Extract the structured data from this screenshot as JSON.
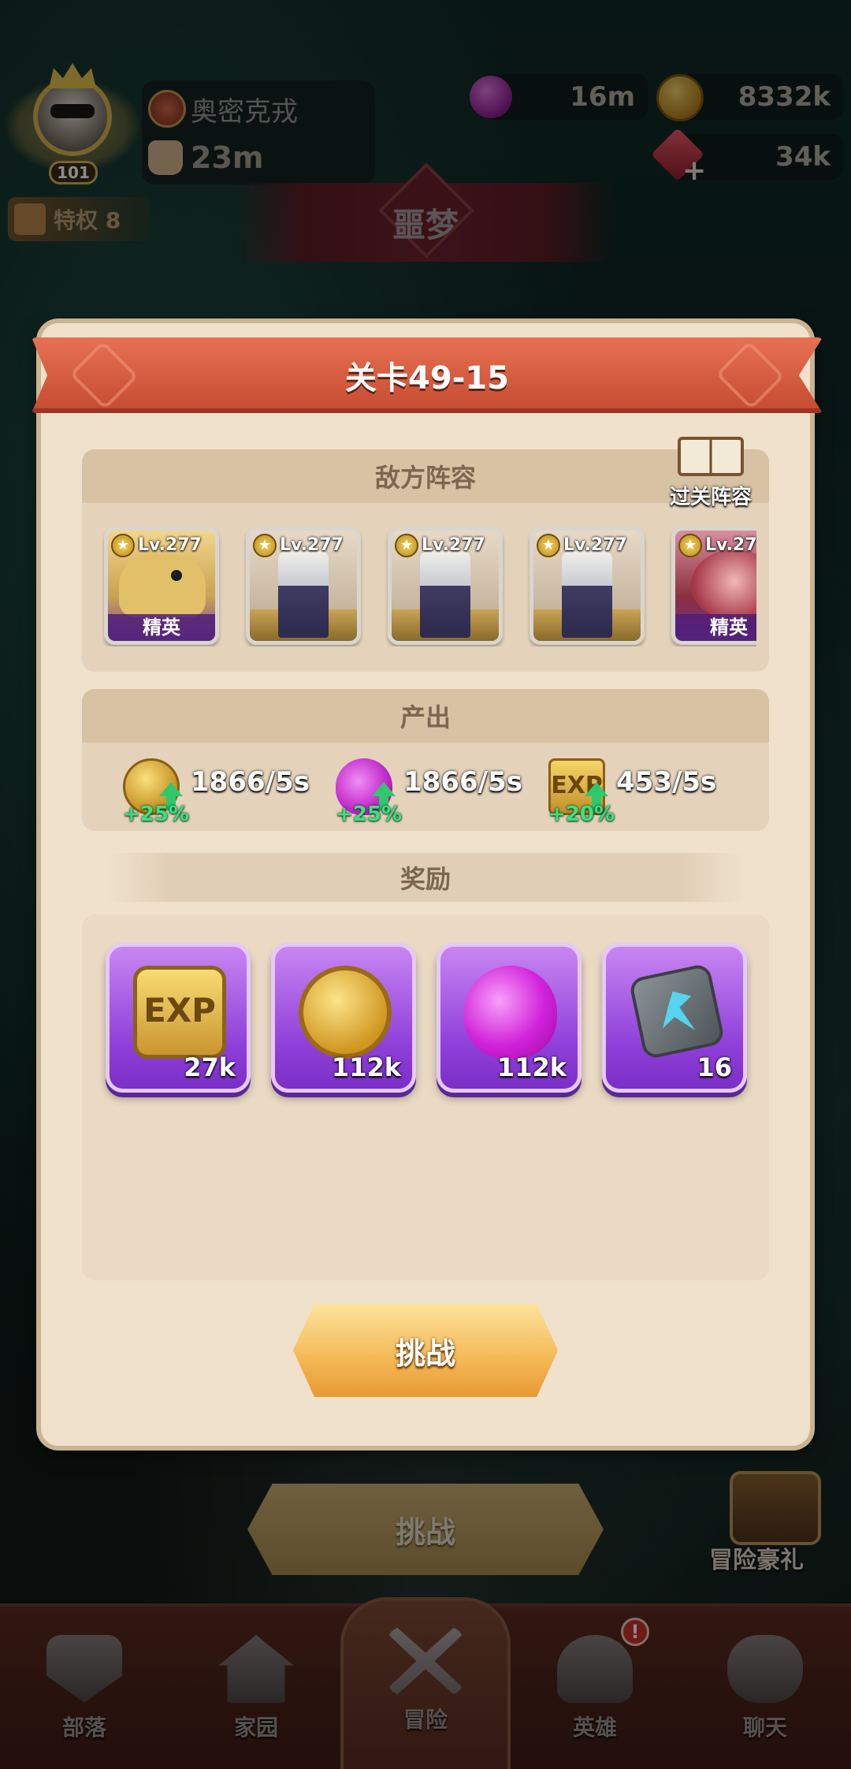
{
  "hud": {
    "player_level": "101",
    "player_name": "奥密克戎",
    "power": "23m",
    "potion_amount": "16m",
    "gold_amount": "8332k",
    "gem_amount": "34k",
    "gem_plus": "+",
    "vip_label": "特权 8",
    "mode_title": "噩梦"
  },
  "modal": {
    "stage_title": "关卡49-15",
    "enemy_section_title": "敌方阵容",
    "lineup_button_label": "过关阵容",
    "enemies": [
      {
        "level": "Lv.277",
        "tag": "精英",
        "art": "beast"
      },
      {
        "level": "Lv.277",
        "tag": "",
        "art": "knight"
      },
      {
        "level": "Lv.277",
        "tag": "",
        "art": "knight"
      },
      {
        "level": "Lv.277",
        "tag": "",
        "art": "knight"
      },
      {
        "level": "Lv.27",
        "tag": "精英",
        "art": "red-beast"
      }
    ],
    "output_section_title": "产出",
    "outputs": [
      {
        "icon": "gold-coin-icon",
        "bonus": "+25%",
        "rate": "1866/5s"
      },
      {
        "icon": "potion-icon",
        "bonus": "+25%",
        "rate": "1866/5s"
      },
      {
        "icon": "exp-icon",
        "bonus": "+20%",
        "rate": "453/5s"
      }
    ],
    "reward_section_title": "奖励",
    "rewards": [
      {
        "icon": "exp-icon",
        "label": "EXP",
        "quantity": "27k"
      },
      {
        "icon": "gold-coin-icon",
        "quantity": "112k"
      },
      {
        "icon": "potion-icon",
        "quantity": "112k"
      },
      {
        "icon": "rune-stone-icon",
        "quantity": "16"
      }
    ],
    "challenge_button_label": "挑战"
  },
  "background": {
    "challenge_button_label": "挑战",
    "adventure_gift_label": "冒险豪礼"
  },
  "nav": {
    "items": [
      {
        "label": "部落",
        "icon": "tribe-shield-icon"
      },
      {
        "label": "家园",
        "icon": "home-icon"
      },
      {
        "label": "冒险",
        "icon": "crossed-swords-icon"
      },
      {
        "label": "英雄",
        "icon": "viking-helmet-icon"
      },
      {
        "label": "聊天",
        "icon": "chat-icon"
      }
    ],
    "active_index": 2,
    "hero_alert": "!"
  },
  "colors": {
    "ribbon": "#d55a3f",
    "modal_bg": "#efe1cc",
    "reward_card": "#9c4ce0",
    "bonus_green": "#3ee07e",
    "button_gold": "#f4b855"
  }
}
